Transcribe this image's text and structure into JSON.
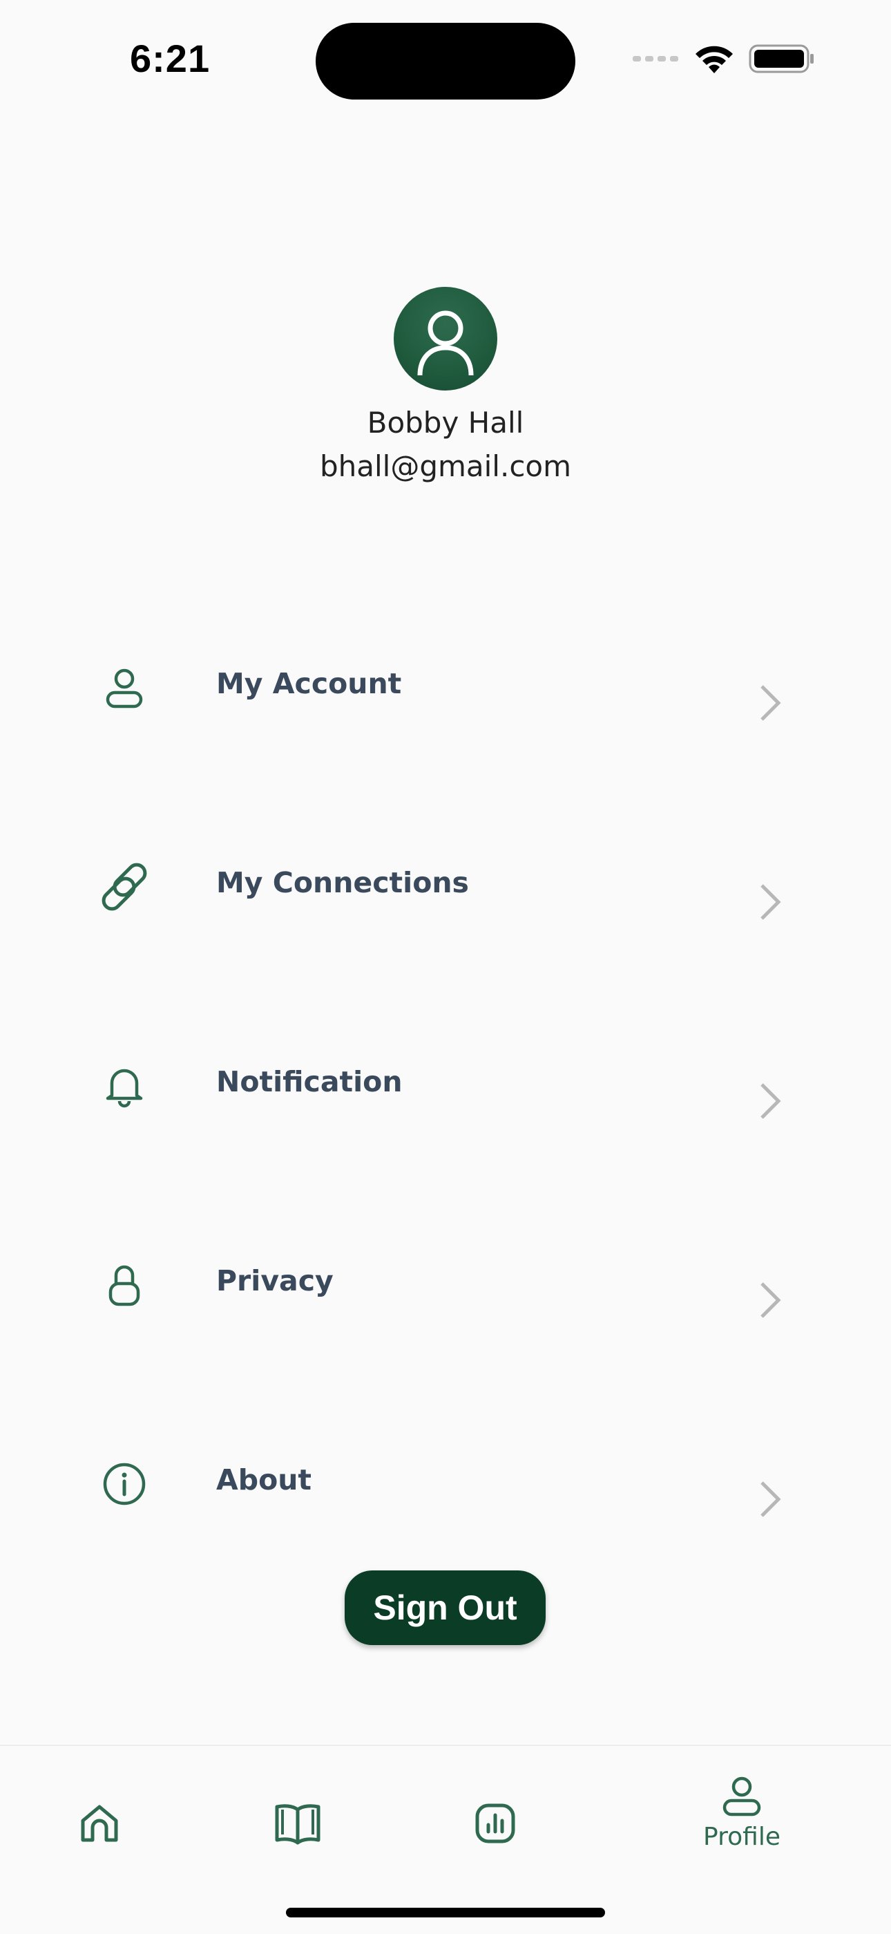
{
  "status_bar": {
    "time": "6:21"
  },
  "profile": {
    "name": "Bobby Hall",
    "email": "bhall@gmail.com"
  },
  "menu": {
    "items": [
      {
        "label": "My Account",
        "icon": "user-icon"
      },
      {
        "label": "My Connections",
        "icon": "link-icon"
      },
      {
        "label": "Notification",
        "icon": "bell-icon"
      },
      {
        "label": "Privacy",
        "icon": "lock-icon"
      },
      {
        "label": "About",
        "icon": "info-icon"
      }
    ]
  },
  "sign_out": {
    "label": "Sign Out"
  },
  "tab_bar": {
    "tabs": [
      {
        "icon": "home-icon",
        "label": ""
      },
      {
        "icon": "book-icon",
        "label": ""
      },
      {
        "icon": "chart-icon",
        "label": ""
      },
      {
        "icon": "profile-icon",
        "label": "Profile"
      }
    ]
  },
  "colors": {
    "accent": "#0b3d26",
    "icon_green": "#2f6a50",
    "label": "#3a4a5c"
  }
}
